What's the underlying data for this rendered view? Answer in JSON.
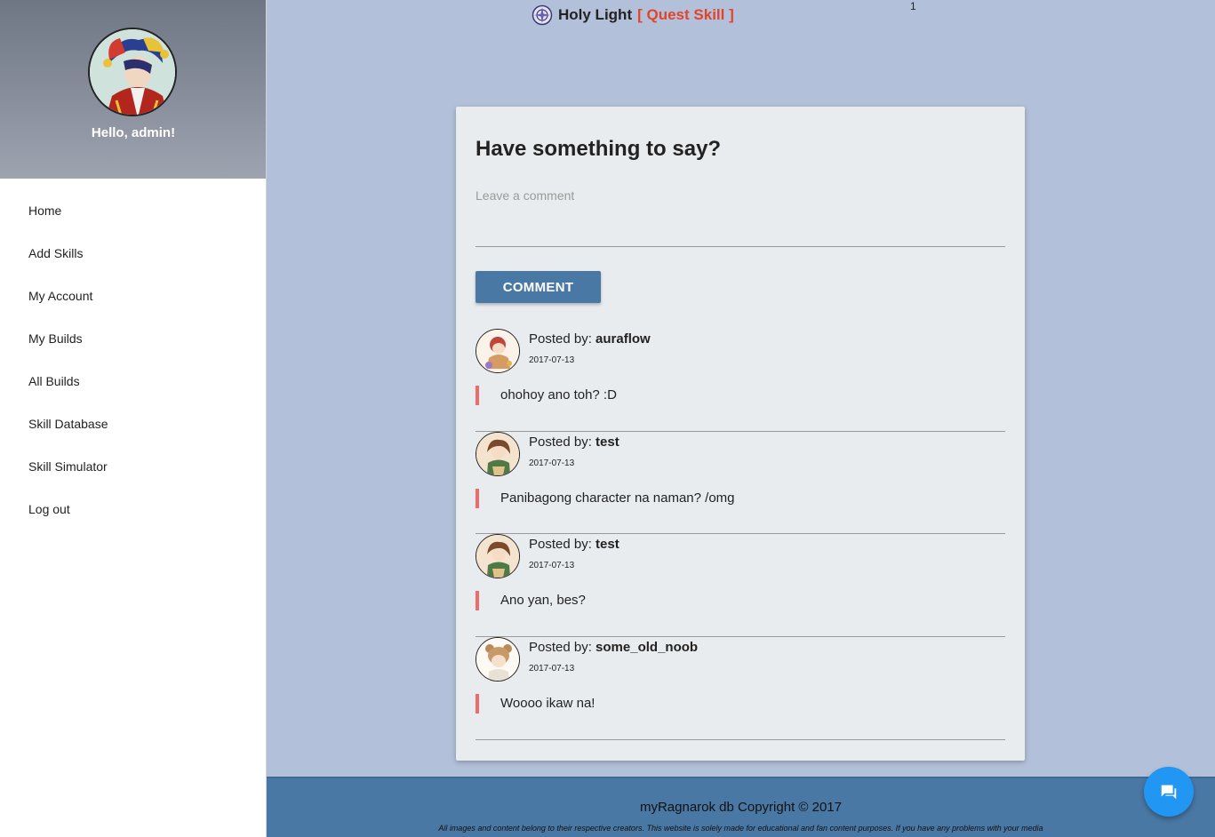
{
  "sidebar": {
    "greeting": "Hello, admin!",
    "avatar_icon": "jester-character-avatar",
    "items": [
      {
        "label": "Home"
      },
      {
        "label": "Add Skills"
      },
      {
        "label": "My Account"
      },
      {
        "label": "My Builds"
      },
      {
        "label": "All Builds"
      },
      {
        "label": "Skill Database"
      },
      {
        "label": "Skill Simulator"
      },
      {
        "label": "Log out"
      }
    ]
  },
  "header": {
    "skill_icon": "holy-light-skill-icon",
    "skill_name": "Holy Light",
    "skill_tag": "[ Quest Skill ]",
    "page_number": "1"
  },
  "comment_form": {
    "title": "Have something to say?",
    "placeholder": "Leave a comment",
    "value": "",
    "button_label": "COMMENT"
  },
  "comments": [
    {
      "posted_label": "Posted by: ",
      "author": "auraflow",
      "date": "2017-07-13",
      "text": "ohohoy ano toh? :D"
    },
    {
      "posted_label": "Posted by: ",
      "author": "test",
      "date": "2017-07-13",
      "text": "Panibagong character na naman? /omg"
    },
    {
      "posted_label": "Posted by: ",
      "author": "test",
      "date": "2017-07-13",
      "text": "Ano yan, bes?"
    },
    {
      "posted_label": "Posted by: ",
      "author": "some_old_noob",
      "date": "2017-07-13",
      "text": "Woooo ikaw na!"
    }
  ],
  "footer": {
    "copyright": "myRagnarok db Copyright © 2017",
    "disclaimer": "All images and content belong to their respective creators. This website is solely made for educational and fan content purposes. If you have any problems with your media"
  },
  "fab": {
    "icon": "chat-icon"
  },
  "colors": {
    "accent": "#4a78a4",
    "fab": "#2196f3",
    "quote_bar": "#ec6b6b",
    "tag": "#e2432a",
    "page_bg": "#b3c0d9"
  }
}
